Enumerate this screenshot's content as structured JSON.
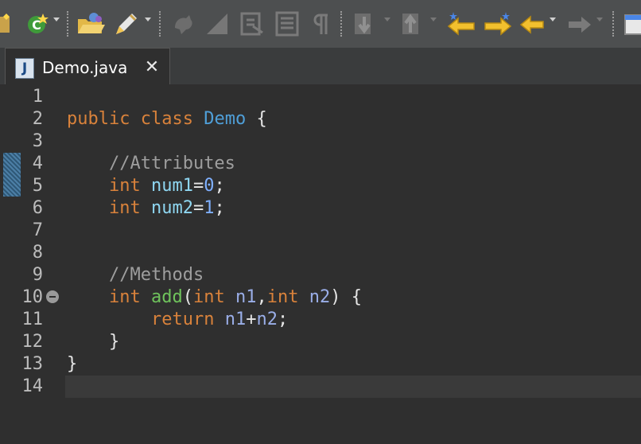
{
  "tab": {
    "title": "Demo.java",
    "file_icon_letter": "J"
  },
  "gutter": {
    "line_numbers": [
      "1",
      "2",
      "3",
      "4",
      "5",
      "6",
      "7",
      "8",
      "9",
      "10",
      "11",
      "12",
      "13",
      "14"
    ]
  },
  "code": {
    "line2": {
      "kw1": "public",
      "kw2": "class",
      "name": "Demo",
      "brace": "{"
    },
    "line4": {
      "comment": "//Attributes"
    },
    "line5": {
      "type": "int",
      "var": "num1",
      "eq": "=",
      "val": "0",
      "semi": ";"
    },
    "line6": {
      "type": "int",
      "var": "num2",
      "eq": "=",
      "val": "1",
      "semi": ";"
    },
    "line9": {
      "comment": "//Methods"
    },
    "line10": {
      "type": "int",
      "fn": "add",
      "open": "(",
      "t1": "int",
      "p1": "n1",
      "comma": ",",
      "t2": "int",
      "p2": "n2",
      "close": ")",
      "brace": "{"
    },
    "line11": {
      "kw": "return",
      "a": "n1",
      "plus": "+",
      "b": "n2",
      "semi": ";"
    },
    "line12": {
      "brace": "}"
    },
    "line13": {
      "brace": "}"
    }
  },
  "colors": {
    "keyword": "#d9823b",
    "class_name": "#4f9fd8",
    "field": "#8fd7f2",
    "number": "#7fb0ff",
    "comment": "#9e9e9e",
    "method": "#6fc35c",
    "background": "#2f2f2f"
  },
  "toolbar": {
    "icons": [
      "new-class-icon",
      "run-icon",
      "open-type-icon",
      "search-icon",
      "toggle-mark-occurrences-icon",
      "toggle-edit-mode-icon",
      "toggle-block-selection-icon",
      "show-whitespace-icon",
      "show-paragraph-icon",
      "next-annotation-icon",
      "previous-annotation-icon",
      "last-edit-location-icon",
      "next-edit-location-icon",
      "back-icon",
      "forward-icon",
      "perspective-icon"
    ]
  }
}
